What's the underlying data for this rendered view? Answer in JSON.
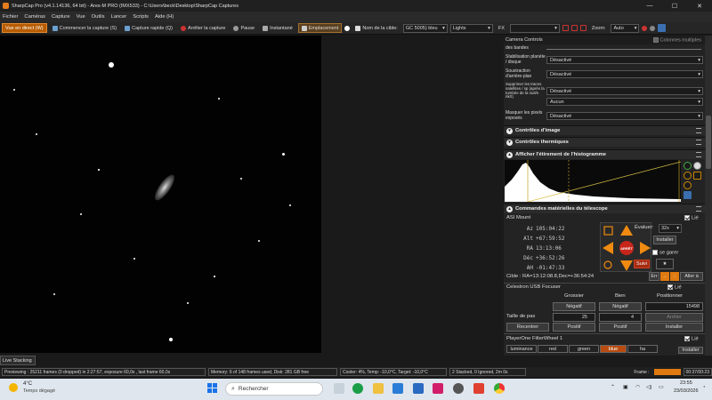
{
  "window": {
    "title": "SharpCap Pro (v4.1.14136, 64 bit) - Ares-M PRO (IMX533) - C:\\Users\\beck\\Desktop\\SharpCap Captures",
    "minimize": "—",
    "maximize": "☐",
    "close": "✕"
  },
  "menu": [
    "Fichier",
    "Caméras",
    "Capture",
    "Vue",
    "Outils",
    "Lancer",
    "Scripts",
    "Aide (H)"
  ],
  "toolbar": {
    "live_view": "Vue en direct (W)",
    "start_capture": "Commencer la capture (S)",
    "quick_capture": "Capture rapide (Q)",
    "stop_capture": "Arrêter la capture",
    "pause": "Pause",
    "snapshot": "Instantané",
    "placement": "Emplacement",
    "target_label": "Nom de la cible:",
    "target_value": "GC 5005) bleu",
    "frame_type": "Lights",
    "fx_label": "FX",
    "zoom_label": "Zoom:",
    "zoom_value": "Auto"
  },
  "camera_controls": {
    "title": "Camera Controls",
    "multi_columns": "Colonnes multiples",
    "partial_label": "des bandes",
    "rows": [
      {
        "label": "Stabilisation planète / disque",
        "value": "Désactivé"
      },
      {
        "label": "Soustraction d'arrière-plan",
        "value": "Désactivé"
      },
      {
        "label": "Supprimer les traces satellites / sp (après la tombée de la nuit/n nkrt)",
        "value": "Désactivé"
      },
      {
        "label": "",
        "value": "Aucun"
      },
      {
        "label": "Masquer les pixels exposés",
        "value": "Désactivé"
      }
    ]
  },
  "sections": {
    "image_controls": "Contrôles d'image",
    "thermal_controls": "Contrôles thermiques",
    "histogram": "Afficher l'étirement de l'histogramme",
    "telescope": "Commandes matérielles du télescope"
  },
  "mount": {
    "name": "ASI Mount",
    "linked": "Lié",
    "coords": [
      {
        "k": "Az",
        "v": "105:04:22"
      },
      {
        "k": "Alt",
        "v": "+67:59:52"
      },
      {
        "k": "RA",
        "v": "13:13:06"
      },
      {
        "k": "Déc",
        "v": "+36:52:26"
      },
      {
        "k": "AH",
        "v": "-01:47:33"
      }
    ],
    "evaluate_label": "Évaluer:",
    "evaluate_value": "32x",
    "install": "Installer",
    "park": "se garer",
    "stop": "ARRÊT",
    "follow": "Suivi",
    "target": "Cible : RA=13:12:08.8,Dec=+36:54:24",
    "error_btn": "Err",
    "goto_btn": "Aller à"
  },
  "focuser": {
    "name": "Celestron USB Focuser",
    "linked": "Lié",
    "col_coarse": "Grossier",
    "col_fine": "Bien",
    "col_position": "Positionner",
    "neg1": "Négatif",
    "neg2": "Négatif",
    "position_value": "15498",
    "step_label": "Taille de pas",
    "step_coarse": "25",
    "step_fine": "4",
    "stop": "Arrêter",
    "pos1": "Positif",
    "pos2": "Positif",
    "back": "Recentrer",
    "install": "Installer"
  },
  "filterwheel": {
    "name": "PlayerOne FilterWheel 1",
    "linked": "Lié",
    "filters": [
      "luminance",
      "red",
      "green",
      "blue",
      "ha"
    ],
    "active": "blue",
    "install": "Installer"
  },
  "live_stacking": "Live Stacking",
  "status": {
    "preview": "Previewing : 25211 frames (0 dropped) in 2:27:57, exposure 60,0s , last frame 60,0s",
    "memory": "Memory: 6 of 148 frames used, Disk: 281 GB free",
    "cooler": "Cooler: 4%, Temp: -10,0°C, Target: -10,0°C",
    "stacked": "2 Stacked, 0 Ignored, 2m 0s",
    "frame_label": "Frame :",
    "frame_time": "00:37/00:23"
  },
  "taskbar": {
    "weather_temp": "4°C",
    "weather_desc": "Temps dégagé",
    "search": "Rechercher",
    "time": "23:55",
    "date": "23/03/2026"
  },
  "colors": {
    "accent": "#e57c1e",
    "stop_red": "#c8261b",
    "filter_active": "#b84c10"
  }
}
